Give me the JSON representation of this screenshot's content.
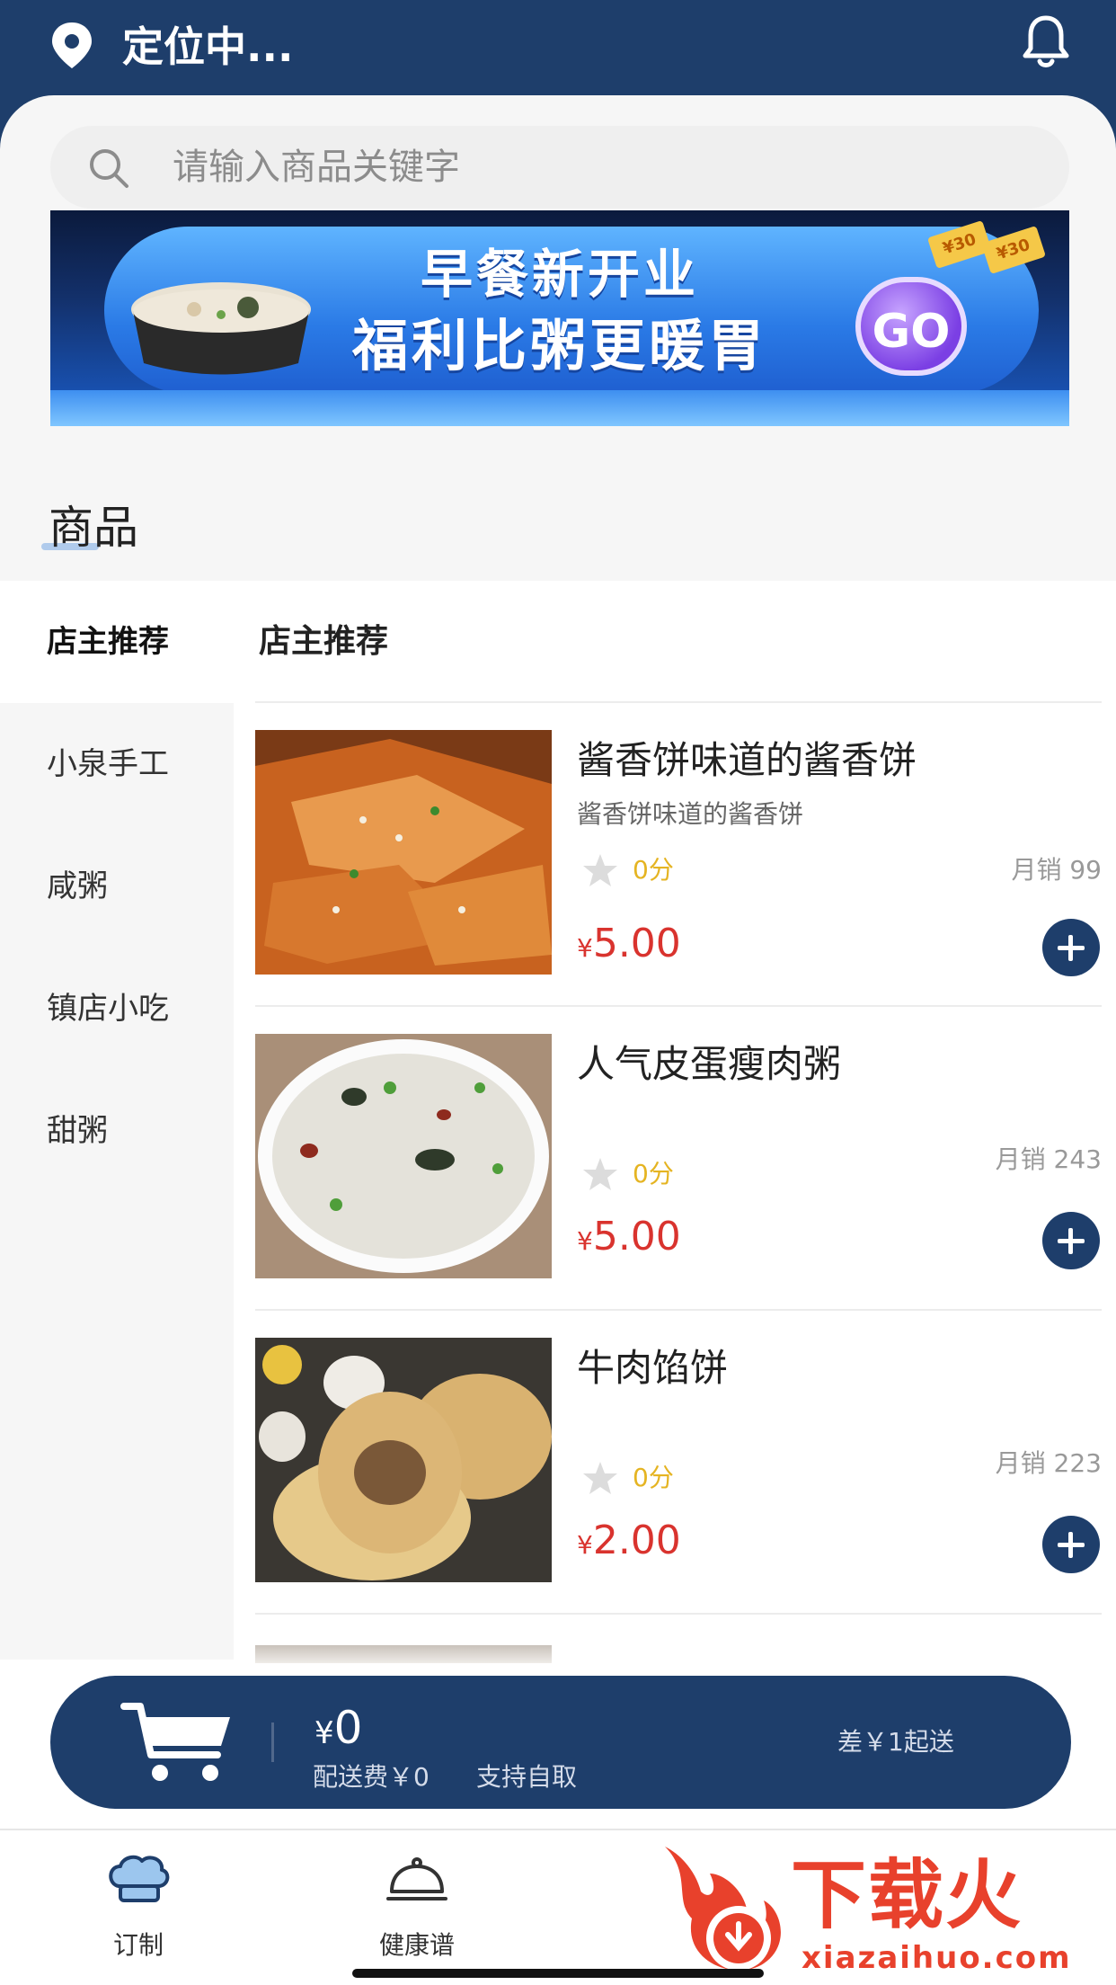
{
  "header": {
    "location_text": "定位中...",
    "icons": {
      "location": "location-pin-icon",
      "notification": "bell-icon"
    }
  },
  "search": {
    "placeholder": "请输入商品关键字",
    "icon": "search-icon"
  },
  "banner": {
    "line1": "早餐新开业",
    "line2": "福利比粥更暖胃",
    "button": "GO",
    "coupon_1": "¥30",
    "coupon_2": "¥30"
  },
  "section": {
    "title": "商品"
  },
  "categories": [
    {
      "label": "店主推荐",
      "active": true
    },
    {
      "label": "小泉手工",
      "active": false
    },
    {
      "label": "咸粥",
      "active": false
    },
    {
      "label": "镇店小吃",
      "active": false
    },
    {
      "label": "甜粥",
      "active": false
    }
  ],
  "list": {
    "title": "店主推荐"
  },
  "products": [
    {
      "name": "酱香饼味道的酱香饼",
      "desc": "酱香饼味道的酱香饼",
      "score": "0分",
      "sales": "月销 99",
      "currency": "¥",
      "price": "5.00",
      "image": "scallion-pancake-photo"
    },
    {
      "name": "人气皮蛋瘦肉粥",
      "desc": "",
      "score": "0分",
      "sales": "月销 243",
      "currency": "¥",
      "price": "5.00",
      "image": "congee-bowl-photo"
    },
    {
      "name": "牛肉馅饼",
      "desc": "",
      "score": "0分",
      "sales": "月销 223",
      "currency": "¥",
      "price": "2.00",
      "image": "beef-pie-photo"
    }
  ],
  "cart": {
    "currency": "¥",
    "total": "0",
    "delivery_fee": "配送费￥0",
    "pickup": "支持自取",
    "min_order": "差￥1起送"
  },
  "tabs": [
    {
      "label": "订制",
      "icon": "chef-hat-icon"
    },
    {
      "label": "健康谱",
      "icon": "food-cloche-icon"
    }
  ],
  "watermark": {
    "text": "下载火",
    "url": "xiazaihuo.com"
  },
  "colors": {
    "primary": "#1e3e6b",
    "price": "#d9332e",
    "score": "#e5b422",
    "sidebar_bg": "#f6f6f6"
  }
}
